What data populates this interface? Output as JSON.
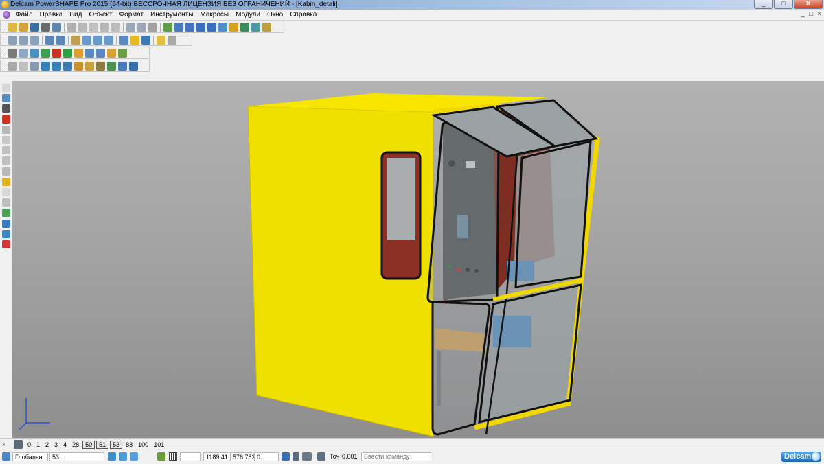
{
  "window": {
    "title": "Delcam PowerSHAPE Pro 2015 (64-bit) БЕССРОЧНАЯ ЛИЦЕНЗИЯ БЕЗ ОГРАНИЧЕНИЙ - [Kabin_detali]",
    "min_label": "_",
    "max_label": "□",
    "close_label": "✕"
  },
  "menu": {
    "items": [
      "Файл",
      "Правка",
      "Вид",
      "Объект",
      "Формат",
      "Инструменты",
      "Макросы",
      "Модули",
      "Окно",
      "Справка"
    ],
    "mdi": [
      "_",
      "□",
      "×"
    ]
  },
  "levels": {
    "items": [
      "0",
      "1",
      "2",
      "3",
      "4",
      "28",
      "50",
      "51",
      "53",
      "88",
      "100",
      "101"
    ],
    "boxed": [
      "50",
      "51",
      "53"
    ]
  },
  "status": {
    "workplane": "Глобальн",
    "level_select": "53 :",
    "x": "1189,41",
    "y": "576,752",
    "z": "0",
    "tol_label": "Точ",
    "tolerance": "0,001",
    "command_placeholder": "Ввести команду",
    "brand": "Delcam"
  },
  "colors": {
    "cab_yellow": "#f2e200",
    "panel_red": "#8a2f24",
    "frame_black": "#111111",
    "glass": "#9ea5a8"
  }
}
